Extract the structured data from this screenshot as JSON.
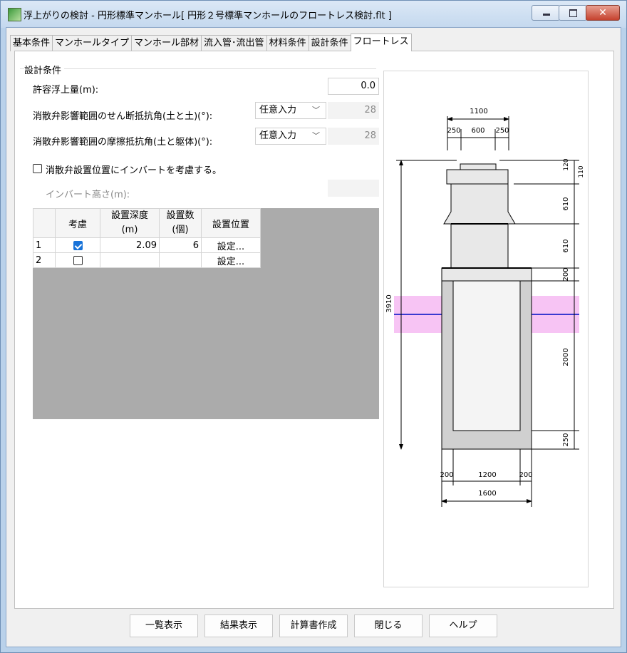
{
  "window": {
    "title": "浮上がりの検討 - 円形標準マンホール[ 円形２号標準マンホールのフロートレス検討.flt ]"
  },
  "tabs": [
    "基本条件",
    "マンホールタイプ",
    "マンホール部材",
    "流入管･流出管",
    "材料条件",
    "設計条件",
    "フロートレス"
  ],
  "active_tab": "フロートレス",
  "group": {
    "title": "設計条件"
  },
  "fields": {
    "allowable_label": "許容浮上量(m):",
    "allowable_value": "0.0",
    "shear_label": "消散弁影響範囲のせん断抵抗角(土と土)(°):",
    "shear_mode": "任意入力",
    "shear_value": "28",
    "friction_label": "消散弁影響範囲の摩擦抵抗角(土と躯体)(°):",
    "friction_mode": "任意入力",
    "friction_value": "28",
    "invert_check_label": "消散弁設置位置にインバートを考慮する。",
    "invert_height_label": "インバート高さ(m):",
    "invert_height_value": ""
  },
  "table": {
    "headers": {
      "consider": "考慮",
      "depth_1": "設置深度",
      "depth_2": "(m)",
      "count_1": "設置数",
      "count_2": "(個)",
      "position": "設置位置"
    },
    "rows": [
      {
        "no": "1",
        "checked": true,
        "depth": "2.09",
        "count": "6",
        "button": "設定..."
      },
      {
        "no": "2",
        "checked": false,
        "depth": "",
        "count": "",
        "button": "設定..."
      }
    ]
  },
  "drawing": {
    "dims": {
      "top_width": "1100",
      "top_w1": "250",
      "top_w2": "600",
      "top_w3": "250",
      "bottom_width": "1600",
      "bottom_w1": "200",
      "bottom_w2": "1200",
      "bottom_w3": "200",
      "total_height": "3910",
      "h_cap": "120",
      "h_cap2": "110",
      "h1": "610",
      "h2": "610",
      "h3": "200",
      "h4": "2000",
      "h5": "250"
    },
    "colors": {
      "outline": "#000000",
      "fill": "#e8e8e8",
      "wall": "#d0d0d0",
      "water_band": "#f7c4f4",
      "water_line": "#3a3ad0"
    }
  },
  "buttons": {
    "list": "一覧表示",
    "result": "結果表示",
    "report": "計算書作成",
    "close": "閉じる",
    "help": "ヘルプ"
  }
}
